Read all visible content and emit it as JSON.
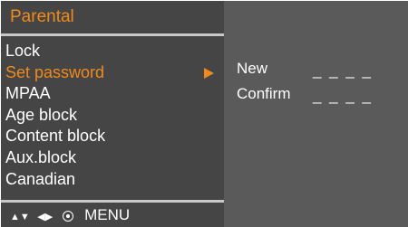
{
  "header": {
    "title": "Parental"
  },
  "menu": {
    "items": [
      {
        "label": "Lock"
      },
      {
        "label": "Set password"
      },
      {
        "label": "MPAA"
      },
      {
        "label": "Age block"
      },
      {
        "label": "Content block"
      },
      {
        "label": "Aux.block"
      },
      {
        "label": "Canadian"
      }
    ],
    "selected_index": 1
  },
  "password": {
    "new_label": "New",
    "new_value": "_ _ _ _",
    "confirm_label": "Confirm",
    "confirm_value": "_ _ _ _"
  },
  "nav": {
    "up_down_glyph": "▲▼",
    "left_right_glyph": "◀▶",
    "ok_icon": "ok-button-icon",
    "menu_label": "MENU"
  },
  "colors": {
    "accent": "#f08a1c",
    "panel_left": "#454545",
    "panel_right": "#5a5a5a",
    "divider": "#c9c9c9",
    "text": "#ffffff"
  }
}
